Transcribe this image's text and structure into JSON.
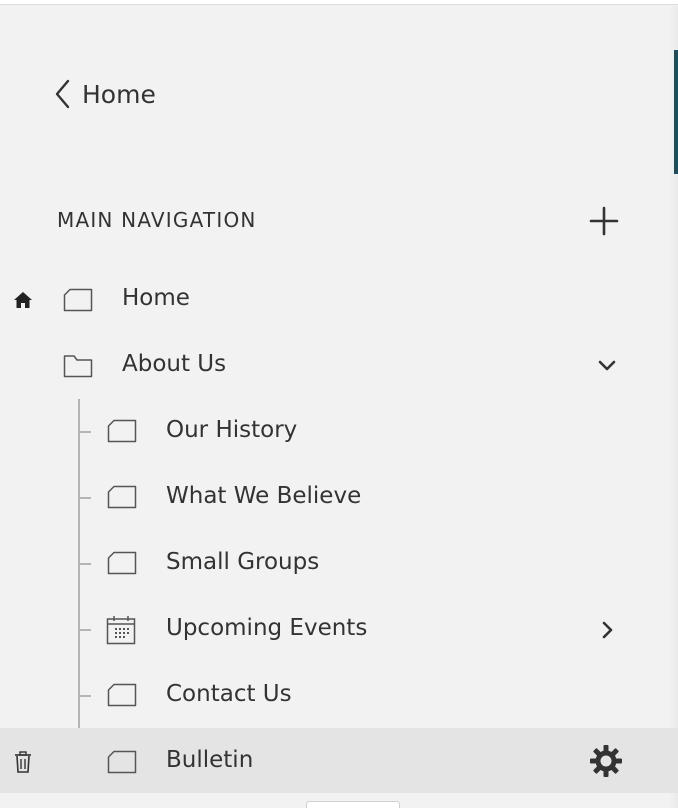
{
  "header": {
    "back_label": "Home"
  },
  "navigation": {
    "section_title": "MAIN NAVIGATION",
    "items": [
      {
        "label": "Home",
        "icon": "page-icon",
        "is_homepage": true
      },
      {
        "label": "About Us",
        "icon": "folder-icon",
        "expanded": true
      },
      {
        "label": "Our History",
        "icon": "page-icon"
      },
      {
        "label": "What We Believe",
        "icon": "page-icon"
      },
      {
        "label": "Small Groups",
        "icon": "page-icon"
      },
      {
        "label": "Upcoming Events",
        "icon": "calendar-icon",
        "has_children": true
      },
      {
        "label": "Contact Us",
        "icon": "page-icon"
      },
      {
        "label": "Bulletin",
        "icon": "page-icon",
        "selected": true
      }
    ]
  },
  "colors": {
    "background": "#f2f2f2",
    "selected_row": "#e4e4e4",
    "text": "#333333",
    "accent": "#1c4e5e"
  }
}
